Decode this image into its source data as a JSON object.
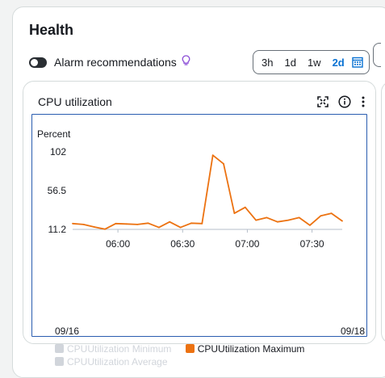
{
  "health": {
    "title": "Health",
    "alarm_toggle_label": "Alarm recommendations",
    "time_range": {
      "options": [
        "3h",
        "1d",
        "1w",
        "2d"
      ],
      "selected": "2d"
    }
  },
  "card": {
    "title": "CPU utilization",
    "icons": [
      "fullscreen-icon",
      "info-icon",
      "more-options-icon"
    ]
  },
  "colors": {
    "accent": "#0972d3",
    "series_max": "#ec7211",
    "disabled": "#d1d5db"
  },
  "chart_data": {
    "type": "line",
    "ylabel": "Percent",
    "y_ticks": [
      "102",
      "56.5",
      "11.2"
    ],
    "x_ticks": [
      "06:00",
      "06:30",
      "07:00",
      "07:30"
    ],
    "date_start": "09/16",
    "date_end": "09/18",
    "ylim": [
      11.2,
      102
    ],
    "series": [
      {
        "name": "CPUUtilization Maximum",
        "enabled": true,
        "color": "#ec7211",
        "points": [
          [
            "05:39",
            18
          ],
          [
            "05:44",
            17
          ],
          [
            "05:49",
            14
          ],
          [
            "05:54",
            11.5
          ],
          [
            "05:59",
            18
          ],
          [
            "06:04",
            17.5
          ],
          [
            "06:09",
            17
          ],
          [
            "06:14",
            18.5
          ],
          [
            "06:19",
            13.5
          ],
          [
            "06:24",
            20
          ],
          [
            "06:29",
            13.5
          ],
          [
            "06:34",
            18.5
          ],
          [
            "06:39",
            18
          ],
          [
            "06:44",
            98
          ],
          [
            "06:49",
            88
          ],
          [
            "06:54",
            30
          ],
          [
            "06:59",
            37
          ],
          [
            "07:04",
            22
          ],
          [
            "07:09",
            25
          ],
          [
            "07:14",
            20
          ],
          [
            "07:19",
            22
          ],
          [
            "07:24",
            25
          ],
          [
            "07:29",
            16
          ],
          [
            "07:34",
            27
          ],
          [
            "07:39",
            30
          ],
          [
            "07:44",
            21
          ]
        ]
      },
      {
        "name": "CPUUtilization Minimum",
        "enabled": false,
        "color": "#d1d5db"
      },
      {
        "name": "CPUUtilization Average",
        "enabled": false,
        "color": "#d1d5db"
      }
    ]
  }
}
